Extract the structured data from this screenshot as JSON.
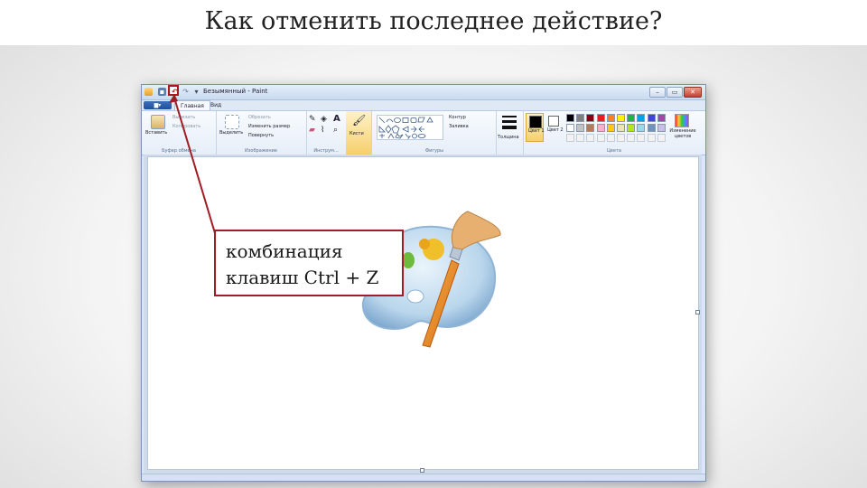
{
  "slide": {
    "title": "Как отменить последнее действие?"
  },
  "window": {
    "title": "Безымянный - Paint",
    "controls": {
      "minimize": "–",
      "maximize": "▭",
      "close": "✕"
    }
  },
  "tabs": {
    "file": "▆▾",
    "home": "Главная",
    "view": "Вид"
  },
  "ribbon": {
    "clipboard": {
      "label": "Буфер обмена",
      "paste": "Вставить",
      "cut": "Вырезать",
      "copy": "Копировать"
    },
    "image": {
      "label": "Изображение",
      "select": "Выделить",
      "crop": "Обрезать",
      "resize": "Изменить размер",
      "rotate": "Повернуть"
    },
    "tools": {
      "label": "Инструм..."
    },
    "brushes": {
      "label": "Кисти"
    },
    "shapes": {
      "label": "Фигуры",
      "outline": "Контур",
      "fill": "Заливка"
    },
    "size": {
      "label": "Толщина"
    },
    "colors": {
      "label": "Цвета",
      "color1": "Цвет 1",
      "color2": "Цвет 2",
      "edit": "Изменение цветов",
      "palette_row1": [
        "#000000",
        "#7f7f7f",
        "#880015",
        "#ed1c24",
        "#ff7f27",
        "#fff200",
        "#22b14c",
        "#00a2e8",
        "#3f48cc",
        "#a349a4"
      ],
      "palette_row2": [
        "#ffffff",
        "#c3c3c3",
        "#b97a57",
        "#ffaec9",
        "#ffc90e",
        "#efe4b0",
        "#b5e61d",
        "#99d9ea",
        "#7092be",
        "#c8bfe7"
      ]
    }
  },
  "callout": {
    "line1": "комбинация",
    "line2": "клавиш Ctrl + Z"
  },
  "colors": {
    "accent": "#a01d24",
    "ribbon_blue": "#1e4f9c"
  }
}
